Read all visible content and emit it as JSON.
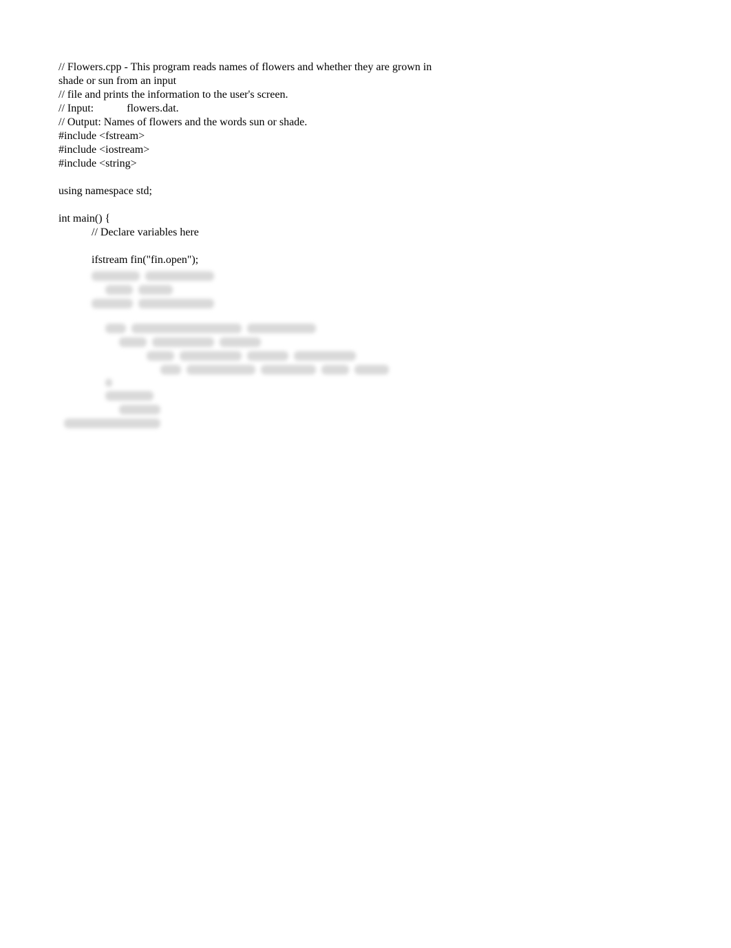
{
  "code": {
    "lines": [
      "// Flowers.cpp - This program reads names of flowers and whether they are grown in shade or sun from an input",
      "// file and prints the information to the user's screen.",
      "// Input:            flowers.dat.",
      "// Output: Names of flowers and the words sun or shade.",
      "#include <fstream>",
      "#include <iostream>",
      "#include <string>"
    ],
    "using_line": "using namespace std;",
    "main_line": "int main() {",
    "declare_comment": "// Declare variables here",
    "ifstream_line": "ifstream fin(\"fin.open\");"
  }
}
